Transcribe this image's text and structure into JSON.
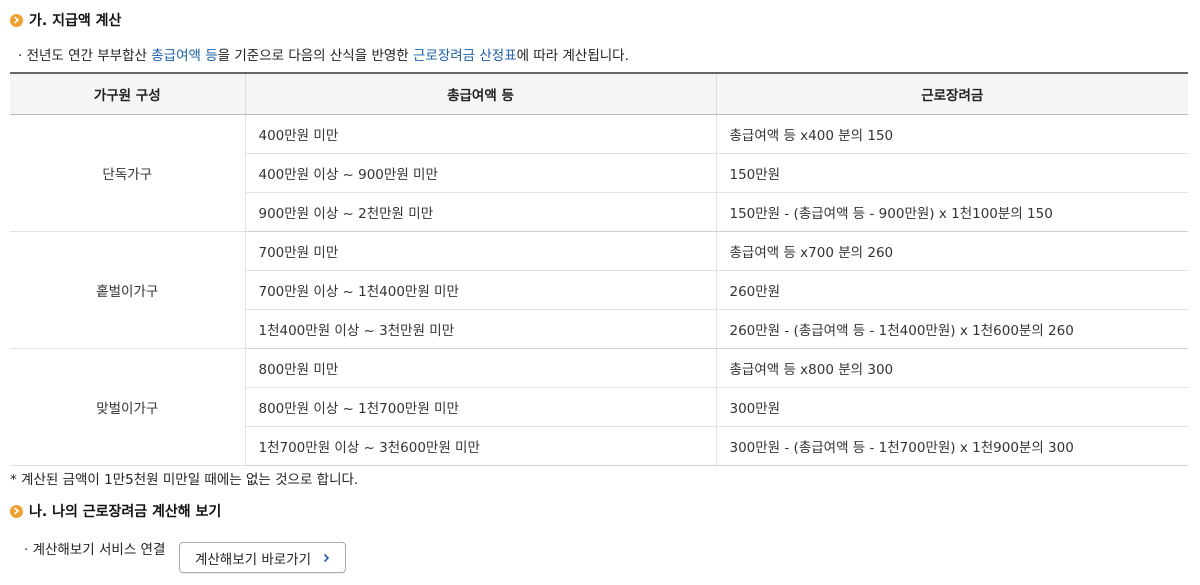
{
  "section1": {
    "title": "가. 지급액 계산",
    "desc_pre": "· 전년도 연간 부부합산 ",
    "desc_hl1": "총급여액 등",
    "desc_mid": "을 기준으로 다음의 산식을 반영한 ",
    "desc_hl2": "근로장려금 산정표",
    "desc_post": "에 따라 계산됩니다."
  },
  "table": {
    "headers": [
      "가구원 구성",
      "총급여액 등",
      "근로장려금"
    ],
    "groups": [
      {
        "name": "단독가구",
        "rows": [
          [
            "400만원 미만",
            "총급여액 등 x400 분의 150"
          ],
          [
            "400만원 이상 ~ 900만원 미만",
            "150만원"
          ],
          [
            "900만원 이상 ~ 2천만원 미만",
            "150만원 - (총급여액 등 - 900만원) x 1천100분의 150"
          ]
        ]
      },
      {
        "name": "홑벌이가구",
        "rows": [
          [
            "700만원 미만",
            "총급여액 등 x700 분의 260"
          ],
          [
            "700만원 이상 ~ 1천400만원 미만",
            "260만원"
          ],
          [
            "1천400만원 이상 ~ 3천만원 미만",
            "260만원 - (총급여액 등 - 1천400만원) x 1천600분의 260"
          ]
        ]
      },
      {
        "name": "맞벌이가구",
        "rows": [
          [
            "800만원 미만",
            "총급여액 등 x800 분의 300"
          ],
          [
            "800만원 이상 ~ 1천700만원 미만",
            "300만원"
          ],
          [
            "1천700만원 이상 ~ 3천600만원 미만",
            "300만원 - (총급여액 등 - 1천700만원) x 1천900분의 300"
          ]
        ]
      }
    ]
  },
  "note": "* 계산된 금액이 1만5천원 미만일 때에는 없는 것으로 합니다.",
  "section2": {
    "title": "나. 나의 근로장려금 계산해 보기",
    "link_label": "· 계산해보기 서비스 연결",
    "button_label": "계산해보기 바로가기"
  },
  "colors": {
    "accent": "#f0a030",
    "highlight": "#1a5fa8"
  },
  "icons": {
    "section_bullet": "chevron-right-circle-icon",
    "button_arrow": "chevron-right-icon"
  }
}
